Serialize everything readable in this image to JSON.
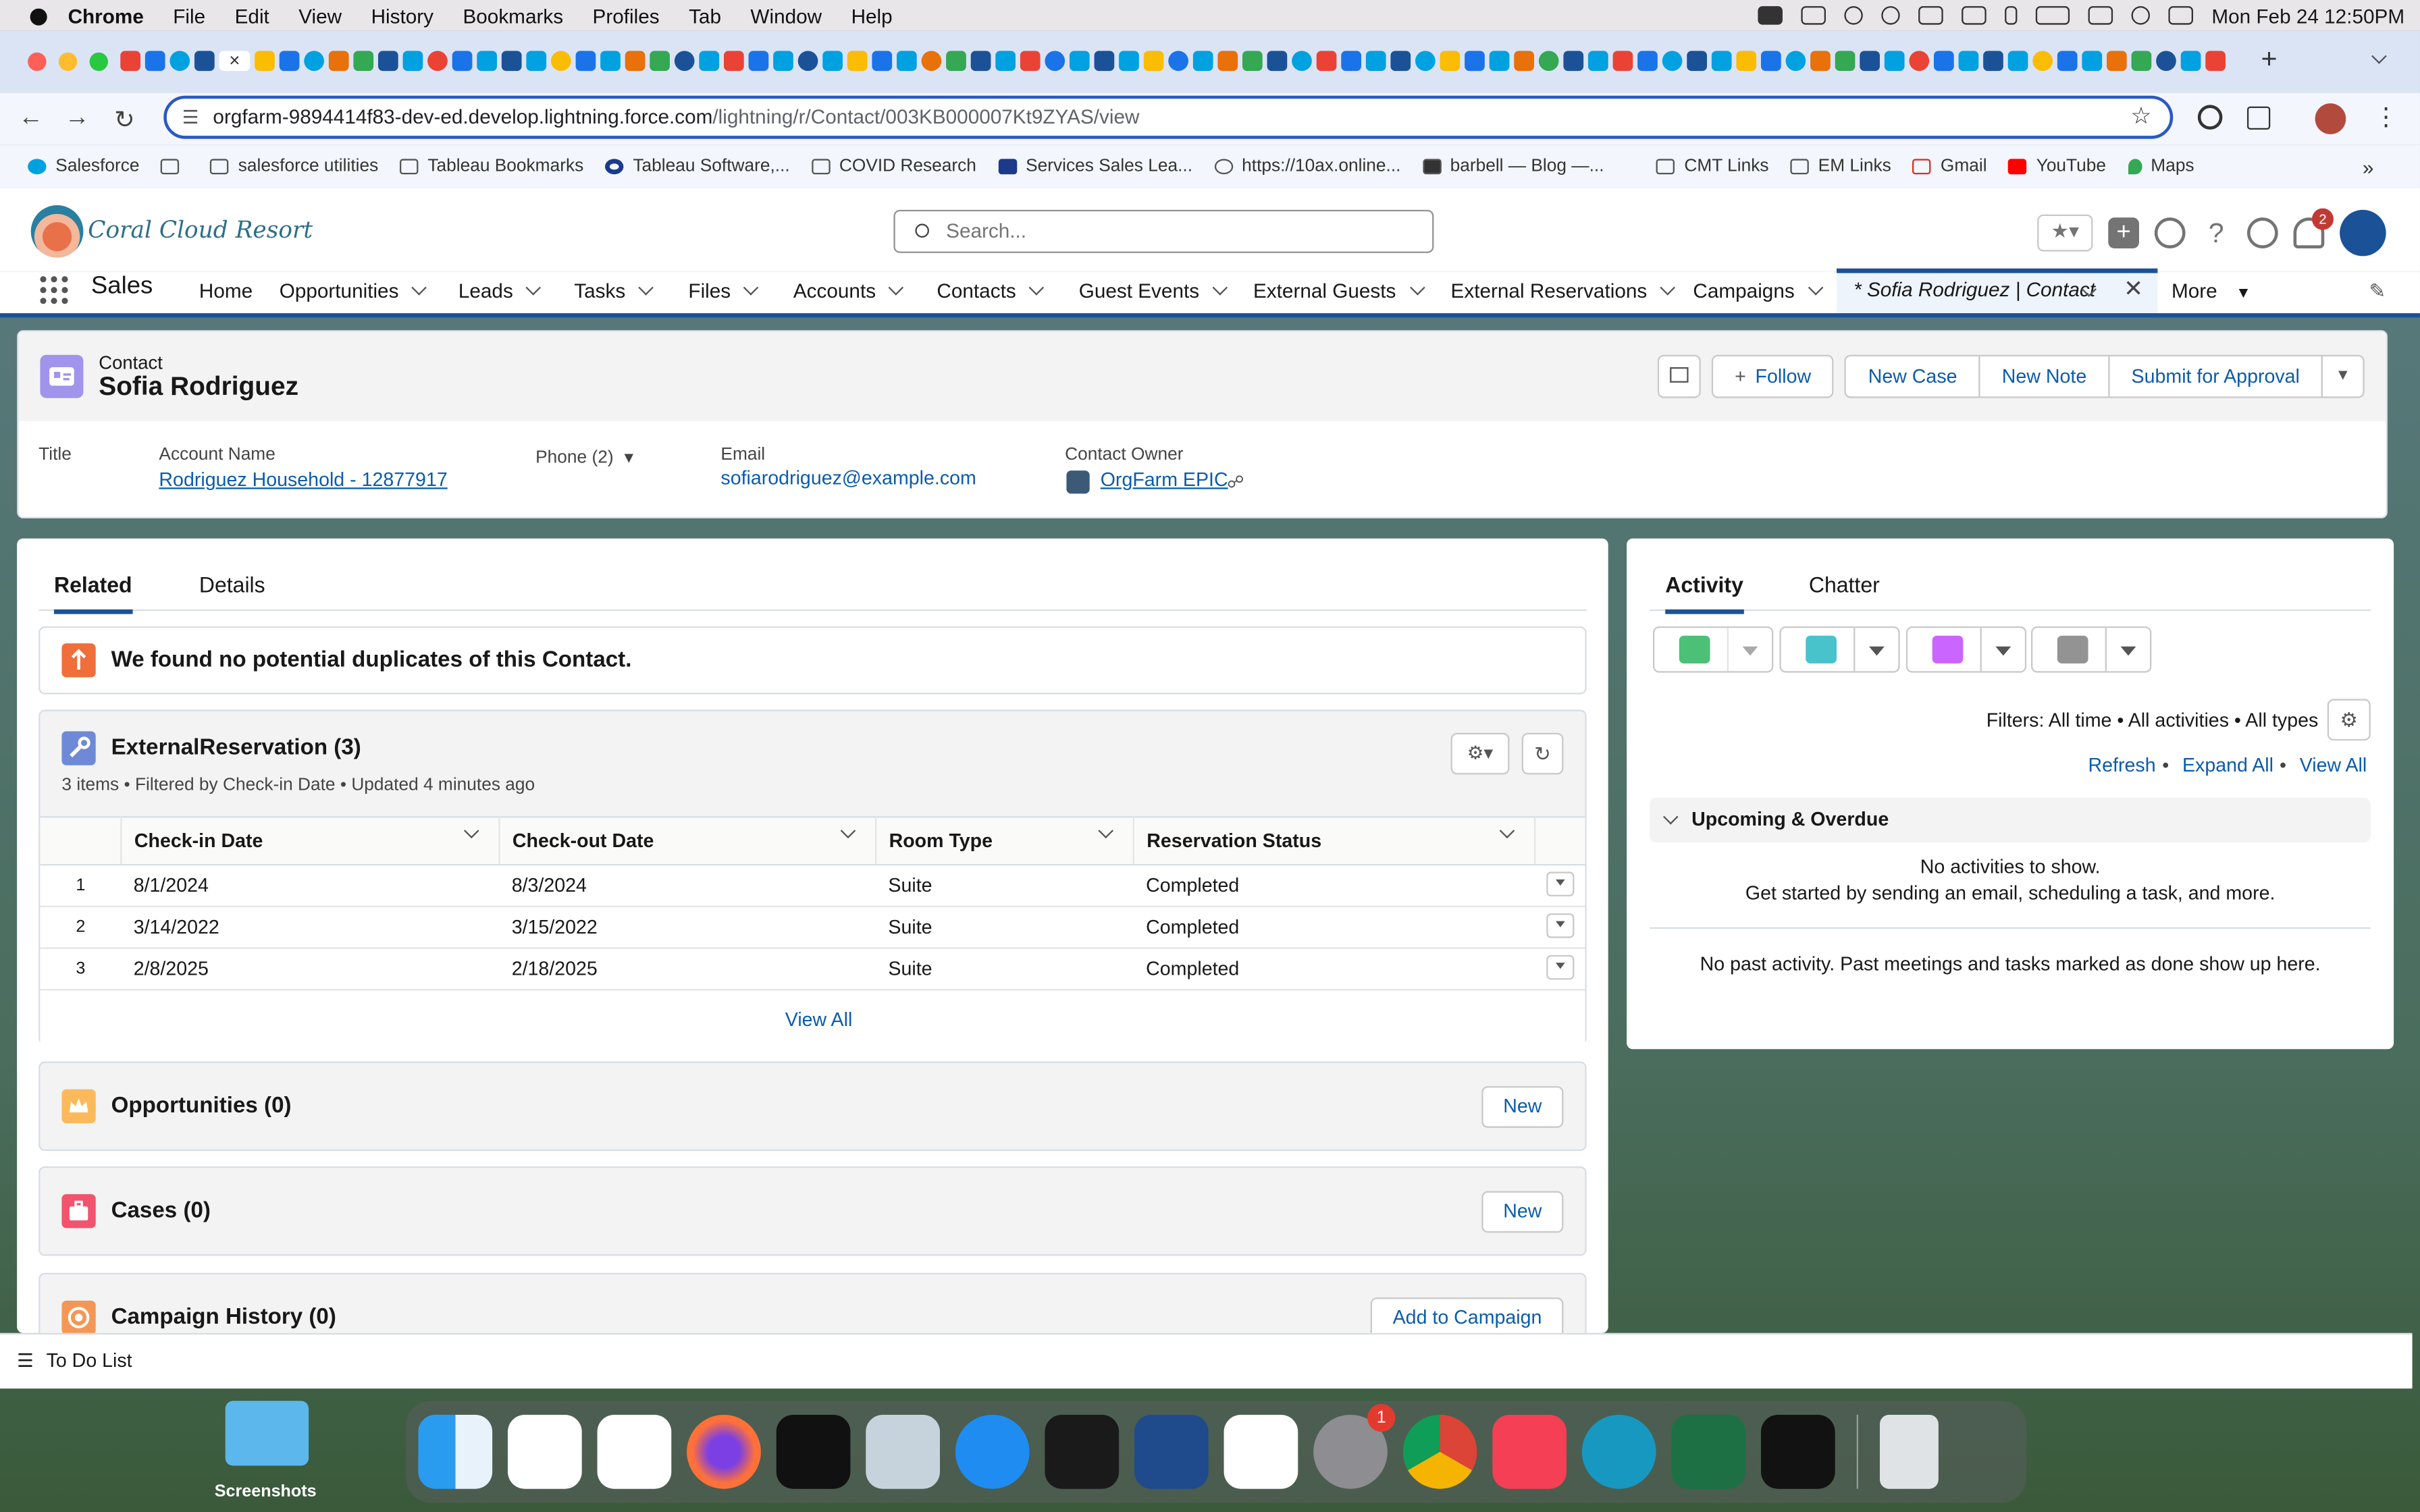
{
  "menubar": {
    "app": "Chrome",
    "items": [
      "File",
      "Edit",
      "View",
      "History",
      "Bookmarks",
      "Profiles",
      "Tab",
      "Window",
      "Help"
    ],
    "clock": "Mon Feb 24  12:50PM"
  },
  "browser": {
    "url_host": "orgfarm-9894414f83-dev-ed.develop.lightning.force.com",
    "url_path": "/lightning/r/Contact/003KB000007Kt9ZYAS/view",
    "bookmarks": [
      "Salesforce",
      "salesforce utilities",
      "Tableau Bookmarks",
      "Tableau Software,...",
      "COVID Research",
      "Services Sales Lea...",
      "https://10ax.online...",
      "barbell — Blog —...",
      "CMT Links",
      "EM Links",
      "Gmail",
      "YouTube",
      "Maps"
    ]
  },
  "sf": {
    "brand": "Coral Cloud Resort",
    "search_placeholder": "Search...",
    "notif_count": "2",
    "app_name": "Sales",
    "nav": [
      "Home",
      "Opportunities",
      "Leads",
      "Tasks",
      "Files",
      "Accounts",
      "Contacts",
      "Guest Events",
      "External Guests",
      "External Reservations",
      "Campaigns"
    ],
    "active_tab": "* Sofia Rodriguez | Contact",
    "more": "More"
  },
  "record": {
    "object": "Contact",
    "name": "Sofia Rodriguez",
    "buttons": {
      "follow": "Follow",
      "new_case": "New Case",
      "new_note": "New Note",
      "submit": "Submit for Approval"
    },
    "fields": {
      "title_label": "Title",
      "account_label": "Account Name",
      "account_value": "Rodriguez Household - 12877917",
      "phone_label": "Phone (2)",
      "email_label": "Email",
      "email_value": "sofiarodriguez@example.com",
      "owner_label": "Contact Owner",
      "owner_value": "OrgFarm EPIC"
    }
  },
  "related": {
    "tabs": [
      "Related",
      "Details"
    ],
    "duplicates": "We found no potential duplicates of this Contact.",
    "reservations": {
      "title": "ExternalReservation (3)",
      "meta": "3 items • Filtered by Check-in Date • Updated 4 minutes ago",
      "columns": [
        "Check-in Date",
        "Check-out Date",
        "Room Type",
        "Reservation Status"
      ],
      "rows": [
        [
          "1",
          "8/1/2024",
          "8/3/2024",
          "Suite",
          "Completed"
        ],
        [
          "2",
          "3/14/2022",
          "3/15/2022",
          "Suite",
          "Completed"
        ],
        [
          "3",
          "2/8/2025",
          "2/18/2025",
          "Suite",
          "Completed"
        ]
      ],
      "view_all": "View All"
    },
    "opportunities": "Opportunities (0)",
    "cases": "Cases (0)",
    "campaigns": "Campaign History (0)",
    "new_label": "New",
    "add_campaign": "Add to Campaign"
  },
  "activity": {
    "tabs": [
      "Activity",
      "Chatter"
    ],
    "filters": "Filters: All time • All activities • All types",
    "links": [
      "Refresh",
      "Expand All",
      "View All"
    ],
    "upcoming": "Upcoming & Overdue",
    "no_activities": "No activities to show.",
    "get_started": "Get started by sending an email, scheduling a task, and more.",
    "no_past": "No past activity. Past meetings and tasks marked as done show up here."
  },
  "utility": {
    "todo": "To Do List"
  },
  "desktop": {
    "folder": "Screenshots",
    "dock_badge": "1"
  },
  "colors": {
    "brand_blue": "#1b5297",
    "link": "#0b5cab"
  }
}
